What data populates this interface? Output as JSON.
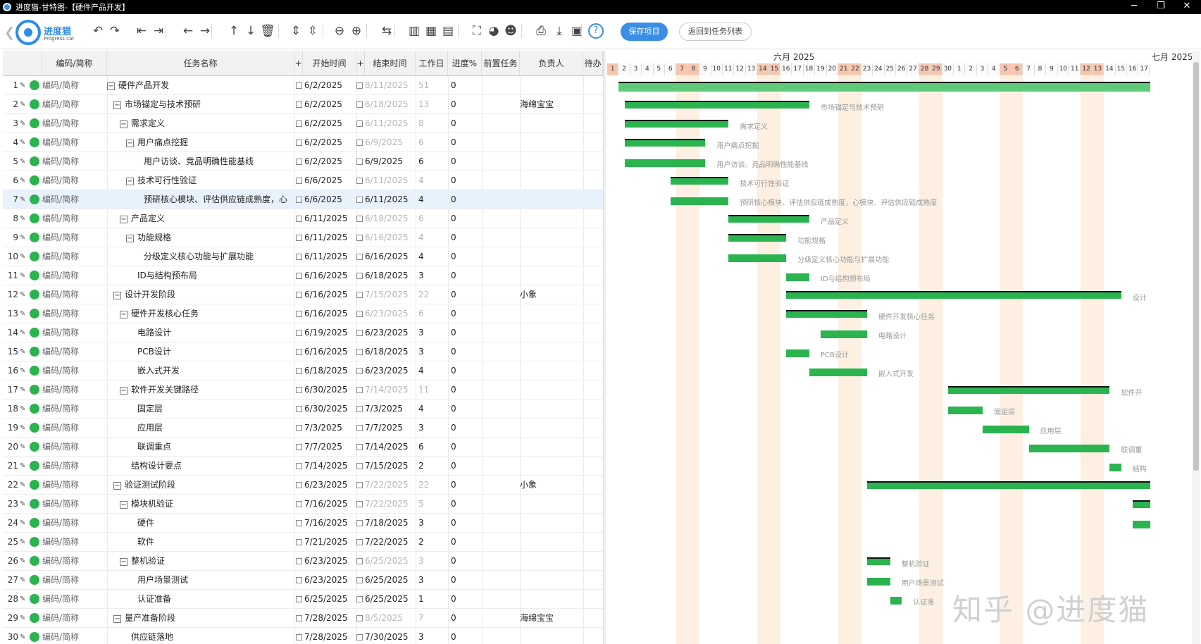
{
  "window": {
    "title": "进度猫-甘特图-【硬件产品开发】",
    "controls": [
      "─",
      "❐",
      "✕"
    ]
  },
  "logo": {
    "name": "进度猫",
    "sub": "Progress cat"
  },
  "toolbar": {
    "icons": [
      "undo-icon",
      "redo-icon",
      "outdent-icon",
      "indent-icon",
      "arrow-left-icon",
      "arrow-right-icon",
      "arrow-up-icon",
      "arrow-down-icon",
      "delete-icon",
      "expand-rows-icon",
      "collapse-rows-icon",
      "zoom-out-icon",
      "zoom-in-icon",
      "link-icon",
      "layout-left-icon",
      "layout-split-icon",
      "layout-right-icon",
      "fullscreen-icon",
      "palette-icon",
      "team-icon",
      "print-icon",
      "download-icon",
      "book-icon",
      "help-icon"
    ],
    "save_label": "保存项目",
    "return_label": "返回到任务列表"
  },
  "columns": {
    "code": "编码/简称",
    "name": "任务名称",
    "plus1": "+",
    "start": "开始时间",
    "plus2": "+",
    "end": "结束时间",
    "work": "工作日",
    "progress": "进度%",
    "pre": "前置任务",
    "owner": "负责人",
    "pending": "待办"
  },
  "rows": [
    {
      "n": "1",
      "code": "编码/简称",
      "name": "硬件产品开发",
      "fold": "−",
      "start": "6/2/2025",
      "end": "8/11/2025",
      "work": "51",
      "prog": "0",
      "owner": "",
      "summary": true
    },
    {
      "n": "2",
      "code": "编码/简称",
      "name": "市场锚定与技术预研",
      "fold": "−",
      "start": "6/2/2025",
      "end": "6/18/2025",
      "work": "13",
      "prog": "0",
      "owner": "海绵宝宝",
      "summary": true
    },
    {
      "n": "3",
      "code": "编码/简称",
      "name": "需求定义",
      "fold": "−",
      "start": "6/2/2025",
      "end": "6/11/2025",
      "work": "8",
      "prog": "0",
      "owner": "",
      "summary": true
    },
    {
      "n": "4",
      "code": "编码/简称",
      "name": "用户痛点挖掘",
      "fold": "−",
      "start": "6/2/2025",
      "end": "6/9/2025",
      "work": "6",
      "prog": "0",
      "owner": "",
      "summary": true
    },
    {
      "n": "5",
      "code": "编码/简称",
      "name": "用户访谈、竞品明确性能基线",
      "fold": "",
      "start": "6/2/2025",
      "end": "6/9/2025",
      "work": "6",
      "prog": "0",
      "owner": "",
      "summary": false
    },
    {
      "n": "6",
      "code": "编码/简称",
      "name": "技术可行性验证",
      "fold": "−",
      "start": "6/6/2025",
      "end": "6/11/2025",
      "work": "4",
      "prog": "0",
      "owner": "",
      "summary": true
    },
    {
      "n": "7",
      "code": "编码/简称",
      "name": "预研核心模块、评估供应链成熟度，心",
      "fold": "",
      "start": "6/6/2025",
      "end": "6/11/2025",
      "work": "4",
      "prog": "0",
      "owner": "",
      "summary": false
    },
    {
      "n": "8",
      "code": "编码/简称",
      "name": "产品定义",
      "fold": "−",
      "start": "6/11/2025",
      "end": "6/18/2025",
      "work": "6",
      "prog": "0",
      "owner": "",
      "summary": true
    },
    {
      "n": "9",
      "code": "编码/简称",
      "name": "功能规格",
      "fold": "−",
      "start": "6/11/2025",
      "end": "6/16/2025",
      "work": "4",
      "prog": "0",
      "owner": "",
      "summary": true
    },
    {
      "n": "10",
      "code": "编码/简称",
      "name": "分级定义核心功能与扩展功能",
      "fold": "",
      "start": "6/11/2025",
      "end": "6/16/2025",
      "work": "4",
      "prog": "0",
      "owner": "",
      "summary": false
    },
    {
      "n": "11",
      "code": "编码/简称",
      "name": "ID与结构预布局",
      "fold": "",
      "start": "6/16/2025",
      "end": "6/18/2025",
      "work": "3",
      "prog": "0",
      "owner": "",
      "summary": false
    },
    {
      "n": "12",
      "code": "编码/简称",
      "name": "设计开发阶段",
      "fold": "−",
      "start": "6/16/2025",
      "end": "7/15/2025",
      "work": "22",
      "prog": "0",
      "owner": "小象",
      "summary": true
    },
    {
      "n": "13",
      "code": "编码/简称",
      "name": "硬件开发核心任务",
      "fold": "−",
      "start": "6/16/2025",
      "end": "6/23/2025",
      "work": "6",
      "prog": "0",
      "owner": "",
      "summary": true
    },
    {
      "n": "14",
      "code": "编码/简称",
      "name": "电路设计",
      "fold": "",
      "start": "6/19/2025",
      "end": "6/23/2025",
      "work": "3",
      "prog": "0",
      "owner": "",
      "summary": false
    },
    {
      "n": "15",
      "code": "编码/简称",
      "name": "PCB设计",
      "fold": "",
      "start": "6/16/2025",
      "end": "6/18/2025",
      "work": "3",
      "prog": "0",
      "owner": "",
      "summary": false
    },
    {
      "n": "16",
      "code": "编码/简称",
      "name": "嵌入式开发",
      "fold": "",
      "start": "6/18/2025",
      "end": "6/23/2025",
      "work": "4",
      "prog": "0",
      "owner": "",
      "summary": false
    },
    {
      "n": "17",
      "code": "编码/简称",
      "name": "软件开发关键路径",
      "fold": "−",
      "start": "6/30/2025",
      "end": "7/14/2025",
      "work": "11",
      "prog": "0",
      "owner": "",
      "summary": true
    },
    {
      "n": "18",
      "code": "编码/简称",
      "name": "固定层",
      "fold": "",
      "start": "6/30/2025",
      "end": "7/3/2025",
      "work": "4",
      "prog": "0",
      "owner": "",
      "summary": false
    },
    {
      "n": "19",
      "code": "编码/简称",
      "name": "应用层",
      "fold": "",
      "start": "7/3/2025",
      "end": "7/7/2025",
      "work": "3",
      "prog": "0",
      "owner": "",
      "summary": false
    },
    {
      "n": "20",
      "code": "编码/简称",
      "name": "联调重点",
      "fold": "",
      "start": "7/7/2025",
      "end": "7/14/2025",
      "work": "6",
      "prog": "0",
      "owner": "",
      "summary": false
    },
    {
      "n": "21",
      "code": "编码/简称",
      "name": "结构设计要点",
      "fold": "",
      "start": "7/14/2025",
      "end": "7/15/2025",
      "work": "2",
      "prog": "0",
      "owner": "",
      "summary": false
    },
    {
      "n": "22",
      "code": "编码/简称",
      "name": "验证测试阶段",
      "fold": "−",
      "start": "6/23/2025",
      "end": "7/22/2025",
      "work": "22",
      "prog": "0",
      "owner": "小象",
      "summary": true
    },
    {
      "n": "23",
      "code": "编码/简称",
      "name": "模块机验证",
      "fold": "−",
      "start": "7/16/2025",
      "end": "7/22/2025",
      "work": "5",
      "prog": "0",
      "owner": "",
      "summary": true
    },
    {
      "n": "24",
      "code": "编码/简称",
      "name": "硬件",
      "fold": "",
      "start": "7/16/2025",
      "end": "7/18/2025",
      "work": "3",
      "prog": "0",
      "owner": "",
      "summary": false
    },
    {
      "n": "25",
      "code": "编码/简称",
      "name": "软件",
      "fold": "",
      "start": "7/21/2025",
      "end": "7/22/2025",
      "work": "2",
      "prog": "0",
      "owner": "",
      "summary": false
    },
    {
      "n": "26",
      "code": "编码/简称",
      "name": "整机验证",
      "fold": "−",
      "start": "6/23/2025",
      "end": "6/25/2025",
      "work": "3",
      "prog": "0",
      "owner": "",
      "summary": true
    },
    {
      "n": "27",
      "code": "编码/简称",
      "name": "用户场景测试",
      "fold": "",
      "start": "6/23/2025",
      "end": "6/25/2025",
      "work": "3",
      "prog": "0",
      "owner": "",
      "summary": false
    },
    {
      "n": "28",
      "code": "编码/简称",
      "name": "认证准备",
      "fold": "",
      "start": "6/25/2025",
      "end": "6/25/2025",
      "work": "1",
      "prog": "0",
      "owner": "",
      "summary": false
    },
    {
      "n": "29",
      "code": "编码/简称",
      "name": "量产准备阶段",
      "fold": "−",
      "start": "7/28/2025",
      "end": "8/5/2025",
      "work": "7",
      "prog": "0",
      "owner": "海绵宝宝",
      "summary": true
    },
    {
      "n": "30",
      "code": "编码/简称",
      "name": "供应链落地",
      "fold": "",
      "start": "7/28/2025",
      "end": "7/30/2025",
      "work": "3",
      "prog": "0",
      "owner": "",
      "summary": false
    }
  ],
  "gantt": {
    "months": [
      "六月 2025",
      "七月 2025"
    ],
    "june_days": 30,
    "july_days_visible": 17,
    "june_weekend_days": [
      1,
      7,
      8,
      14,
      15,
      21,
      22,
      28,
      29
    ],
    "july_weekend_days": [
      5,
      6,
      12,
      13
    ],
    "bar_labels": [
      "",
      "市场锚定与技术预研",
      "需求定义",
      "用户痛点挖掘",
      "用户访谈、竞品明确性能基线",
      "技术可行性验证",
      "预研核心模块、评估供应链成熟度，心模块、评估供应链成熟度",
      "产品定义",
      "功能规格",
      "分级定义核心功能与扩展功能",
      "ID与结构预布局",
      "设计",
      "硬件开发核心任务",
      "电路设计",
      "PCB设计",
      "嵌入式开发",
      "软件开",
      "固定层",
      "应用层",
      "联调重",
      "结构",
      "",
      "",
      "",
      "",
      "整机验证",
      "用户场景测试",
      "认证准",
      "",
      ""
    ]
  },
  "watermark": "知乎 @进度猫",
  "colors": {
    "bar": "#2bb34f",
    "weekend": "#f6c6b0",
    "accent": "#3a8ee6"
  }
}
